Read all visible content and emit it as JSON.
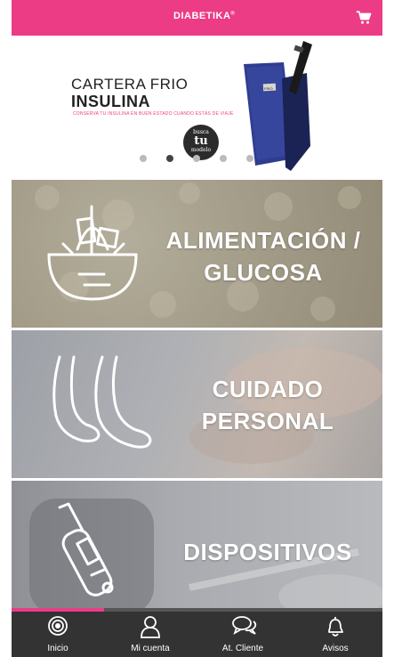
{
  "header": {
    "logo_text": "DIABETIKA",
    "logo_mark": "®",
    "cart_icon": "shopping-cart-icon",
    "background_color": "#ec3c86"
  },
  "banner": {
    "title": "CARTERA FRIO",
    "subtitle": "INSULINA",
    "tagline": "CONSERVA TU INSULINA EN BUEN ESTADO CUANDO ESTÁS DE VIAJE",
    "badge_top": "busca",
    "badge_big": "tu",
    "badge_bottom": "modelo",
    "product_label": "FRIO",
    "slide_count": 5,
    "active_slide": 2
  },
  "categories": [
    {
      "label_line1": "ALIMENTACIÓN /",
      "label_line2": "GLUCOSA",
      "icon": "food-basket-icon"
    },
    {
      "label_line1": "CUIDADO",
      "label_line2": "PERSONAL",
      "icon": "feet-icon"
    },
    {
      "label_line1": "DISPOSITIVOS",
      "label_line2": "",
      "icon": "glucose-meter-icon"
    }
  ],
  "scroll_progress": 0.25,
  "nav": {
    "items": [
      {
        "label": "Inicio",
        "icon": "home-target-icon"
      },
      {
        "label": "Mi cuenta",
        "icon": "user-icon"
      },
      {
        "label": "At. Cliente",
        "icon": "chat-bubbles-icon"
      },
      {
        "label": "Avisos",
        "icon": "bell-icon"
      }
    ]
  },
  "colors": {
    "accent": "#ec3c86",
    "nav_bg": "#333333"
  }
}
